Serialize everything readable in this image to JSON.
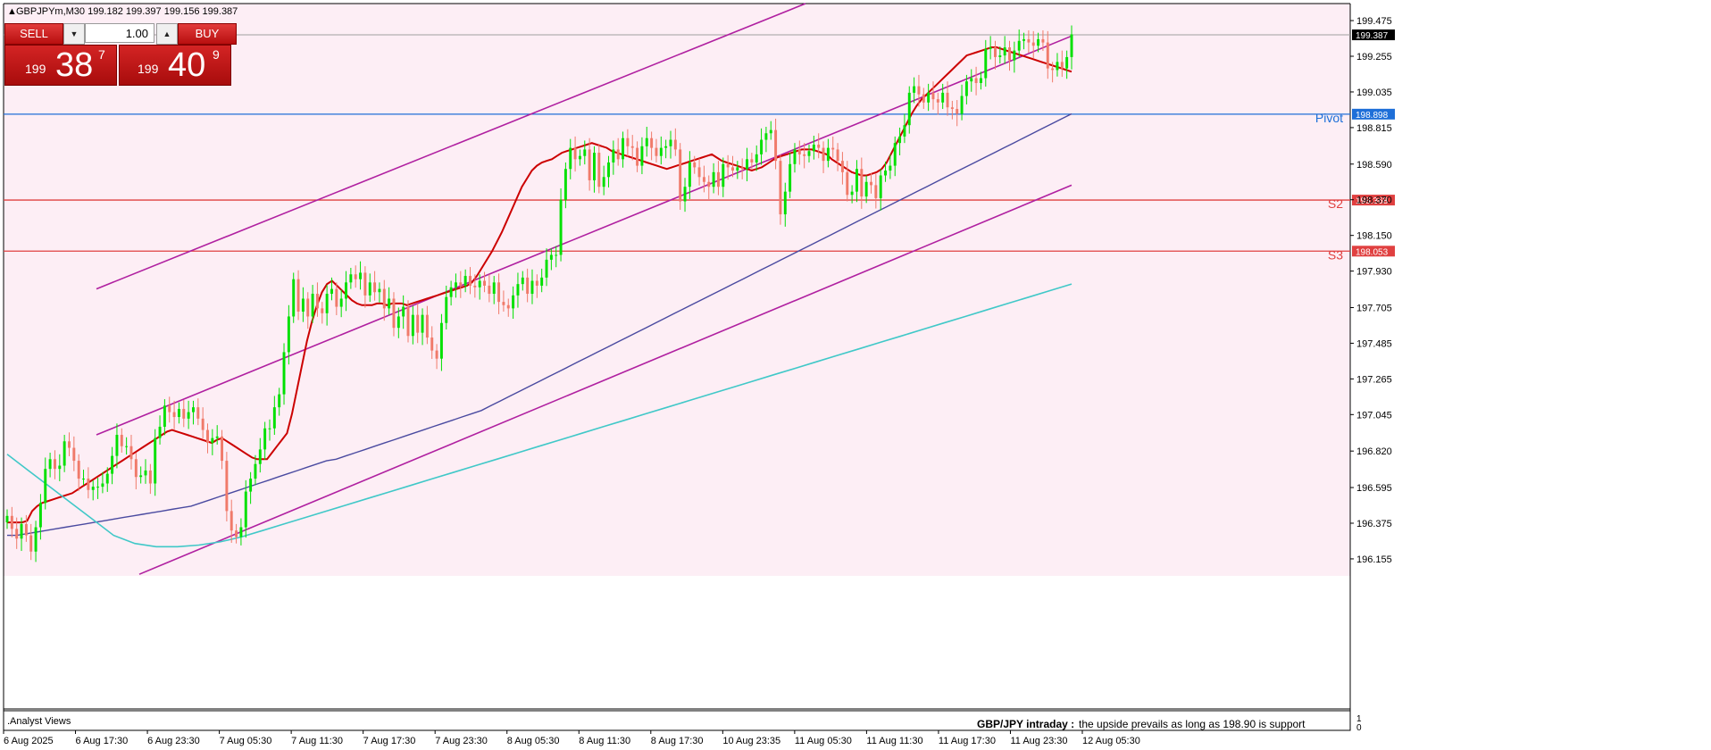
{
  "header": {
    "symbol_line": "GBPJPYm,M30  199.182 199.397 199.156 199.387"
  },
  "trade_panel": {
    "sell_label": "SELL",
    "buy_label": "BUY",
    "lot_value": "1.00",
    "sell_quote": {
      "small": "199",
      "big": "38",
      "sup": "7"
    },
    "buy_quote": {
      "small": "199",
      "big": "40",
      "sup": "9"
    }
  },
  "indicator_panel": {
    "title": ".Analyst Views",
    "comment_bold": "GBP/JPY intraday :",
    "comment_text": " the upside prevails as long as 198.90 is support",
    "scale_top": "1",
    "scale_bottom": "0"
  },
  "colors": {
    "background": "#fdeef5",
    "bull_candle": "#00e000",
    "bear_candle": "#f07a6a",
    "ma_fast": "#cc0000",
    "ma_mid": "#4a4aa0",
    "ma_slow": "#40c8c8",
    "channel": "#b020a0",
    "pivot": "#1e6fd8",
    "support": "#e04040"
  },
  "chart_data": {
    "type": "candlestick",
    "ylim": [
      196.05,
      199.58
    ],
    "y_ticks": [
      "199.475",
      "199.255",
      "199.035",
      "198.815",
      "198.590",
      "198.370",
      "198.150",
      "197.930",
      "197.705",
      "197.485",
      "197.265",
      "197.045",
      "196.820",
      "196.595",
      "196.375",
      "196.155"
    ],
    "x_ticks": [
      "6 Aug 2025",
      "6 Aug 17:30",
      "6 Aug 23:30",
      "7 Aug 05:30",
      "7 Aug 11:30",
      "7 Aug 17:30",
      "7 Aug 23:30",
      "8 Aug 05:30",
      "8 Aug 11:30",
      "8 Aug 17:30",
      "10 Aug 23:35",
      "11 Aug 05:30",
      "11 Aug 11:30",
      "11 Aug 17:30",
      "11 Aug 23:30",
      "12 Aug 05:30"
    ],
    "current_price": "199.387",
    "levels": [
      {
        "name": "Pivot",
        "value": 198.898,
        "label": "198.898"
      },
      {
        "name": "S2",
        "value": 198.368,
        "label": "198.368"
      },
      {
        "name": "S3",
        "value": 198.053,
        "label": "198.053"
      }
    ],
    "closes": [
      196.42,
      196.34,
      196.28,
      196.37,
      196.3,
      196.2,
      196.35,
      196.5,
      196.71,
      196.77,
      196.71,
      196.73,
      196.88,
      196.84,
      196.76,
      196.65,
      196.65,
      196.58,
      196.6,
      196.6,
      196.62,
      196.68,
      196.79,
      196.92,
      196.85,
      196.85,
      196.77,
      196.66,
      196.67,
      196.7,
      196.62,
      196.9,
      196.97,
      197.1,
      197.06,
      197.03,
      197.08,
      197.02,
      197.06,
      197.09,
      197.02,
      196.95,
      196.87,
      196.9,
      196.91,
      196.76,
      196.45,
      196.33,
      196.29,
      196.35,
      196.57,
      196.65,
      196.74,
      196.83,
      196.96,
      196.96,
      197.09,
      197.17,
      197.43,
      197.65,
      197.88,
      197.68,
      197.76,
      197.65,
      197.79,
      197.7,
      197.67,
      197.79,
      197.82,
      197.71,
      197.76,
      197.86,
      197.91,
      197.88,
      197.92,
      197.78,
      197.86,
      197.8,
      197.82,
      197.7,
      197.76,
      197.58,
      197.65,
      197.71,
      197.53,
      197.66,
      197.55,
      197.66,
      197.52,
      197.44,
      197.39,
      197.61,
      197.77,
      197.83,
      197.86,
      197.84,
      197.9,
      197.84,
      197.83,
      197.87,
      197.84,
      197.79,
      197.86,
      197.74,
      197.72,
      197.7,
      197.78,
      197.85,
      197.89,
      197.79,
      197.87,
      197.84,
      197.89,
      198.0,
      198.03,
      198.03,
      198.37,
      198.56,
      198.69,
      198.62,
      198.64,
      198.68,
      198.49,
      198.66,
      198.45,
      198.51,
      198.6,
      198.68,
      198.62,
      198.75,
      198.7,
      198.69,
      198.58,
      198.7,
      198.75,
      198.69,
      198.64,
      198.69,
      198.7,
      198.74,
      198.68,
      198.36,
      198.45,
      198.6,
      198.57,
      198.51,
      198.48,
      198.45,
      198.54,
      198.45,
      198.59,
      198.57,
      198.55,
      198.57,
      198.56,
      198.62,
      198.6,
      198.65,
      198.74,
      198.78,
      198.8,
      198.61,
      198.28,
      198.42,
      198.59,
      198.68,
      198.65,
      198.64,
      198.67,
      198.71,
      198.69,
      198.61,
      198.69,
      198.68,
      198.61,
      198.54,
      198.4,
      198.42,
      198.56,
      198.39,
      198.48,
      198.46,
      198.38,
      198.52,
      198.55,
      198.58,
      198.72,
      198.76,
      198.83,
      199.03,
      199.07,
      199.02,
      198.97,
      199.03,
      198.99,
      198.97,
      199.03,
      198.94,
      198.93,
      198.9,
      199.01,
      199.1,
      199.12,
      199.09,
      199.12,
      199.3,
      199.31,
      199.25,
      199.26,
      199.31,
      199.23,
      199.29,
      199.35,
      199.36,
      199.34,
      199.32,
      199.36,
      199.34,
      199.18,
      199.17,
      199.22,
      199.18,
      199.25,
      199.39
    ],
    "series": [
      {
        "name": "fast MA",
        "values": [
          196.38,
          196.38,
          196.38,
          196.38,
          196.39,
          196.45,
          196.48,
          196.5,
          196.51,
          196.52,
          196.53,
          196.54,
          196.55,
          196.56,
          196.58,
          196.6,
          196.62,
          196.64,
          196.66,
          196.68,
          196.7,
          196.72,
          196.74,
          196.76,
          196.78,
          196.8,
          196.82,
          196.84,
          196.86,
          196.88,
          196.9,
          196.92,
          196.94,
          196.95,
          196.94,
          196.93,
          196.92,
          196.91,
          196.9,
          196.89,
          196.88,
          196.87,
          196.89,
          196.9,
          196.88,
          196.86,
          196.84,
          196.82,
          196.8,
          196.78,
          196.77,
          196.77,
          196.77,
          196.81,
          196.85,
          196.89,
          196.93,
          197.05,
          197.2,
          197.35,
          197.5,
          197.62,
          197.72,
          197.8,
          197.85,
          197.87,
          197.84,
          197.81,
          197.78,
          197.75,
          197.73,
          197.72,
          197.72,
          197.72,
          197.73,
          197.73,
          197.72,
          197.73,
          197.73,
          197.73,
          197.72,
          197.73,
          197.74,
          197.75,
          197.76,
          197.77,
          197.78,
          197.79,
          197.8,
          197.81,
          197.82,
          197.83,
          197.84,
          197.86,
          197.9,
          197.95,
          198.0,
          198.05,
          198.11,
          198.17,
          198.24,
          198.31,
          198.38,
          198.45,
          198.5,
          198.55,
          198.58,
          198.6,
          198.61,
          198.62,
          198.64,
          198.66,
          198.67,
          198.68,
          198.69,
          198.7,
          198.71,
          198.72,
          198.71,
          198.7,
          198.69,
          198.67,
          198.66,
          198.65,
          198.64,
          198.63,
          198.62,
          198.61,
          198.6,
          198.59,
          198.58,
          198.57,
          198.56,
          198.57,
          198.58,
          198.59,
          198.6,
          198.61,
          198.62,
          198.63,
          198.64,
          198.65,
          198.63,
          198.61,
          198.6,
          198.59,
          198.58,
          198.57,
          198.56,
          198.55,
          198.56,
          198.57,
          198.59,
          198.61,
          198.63,
          198.64,
          198.65,
          198.66,
          198.67,
          198.68,
          198.68,
          198.68,
          198.67,
          198.66,
          198.65,
          198.62,
          198.6,
          198.58,
          198.56,
          198.54,
          198.53,
          198.52,
          198.52,
          198.53,
          198.54,
          198.56,
          198.6,
          198.66,
          198.72,
          198.78,
          198.84,
          198.9,
          198.95,
          198.99,
          199.02,
          199.05,
          199.08,
          199.11,
          199.14,
          199.17,
          199.2,
          199.23,
          199.26,
          199.27,
          199.28,
          199.29,
          199.3,
          199.31,
          199.31,
          199.3,
          199.29,
          199.28,
          199.27,
          199.26,
          199.25,
          199.24,
          199.23,
          199.22,
          199.21,
          199.2,
          199.19,
          199.18,
          199.17,
          199.16
        ]
      },
      {
        "name": "mid MA",
        "values": [
          196.3,
          196.3,
          196.31,
          196.32,
          196.33,
          196.34,
          196.35,
          196.36,
          196.37,
          196.38,
          196.39,
          196.4,
          196.41,
          196.42,
          196.43,
          196.44,
          196.45,
          196.46,
          196.47,
          196.48,
          196.5,
          196.52,
          196.54,
          196.56,
          196.58,
          196.6,
          196.62,
          196.64,
          196.66,
          196.68,
          196.7,
          196.72,
          196.74,
          196.76,
          196.77,
          196.79,
          196.81,
          196.83,
          196.85,
          196.87,
          196.89,
          196.91,
          196.93,
          196.95,
          196.97,
          196.99,
          197.01,
          197.03,
          197.05,
          197.07,
          197.1,
          197.13,
          197.16,
          197.19,
          197.22,
          197.25,
          197.28,
          197.31,
          197.34,
          197.37,
          197.4,
          197.43,
          197.46,
          197.49,
          197.52,
          197.55,
          197.58,
          197.61,
          197.64,
          197.67,
          197.7,
          197.73,
          197.76,
          197.79,
          197.82,
          197.85,
          197.88,
          197.91,
          197.94,
          197.97,
          198.0,
          198.03,
          198.06,
          198.09,
          198.12,
          198.15,
          198.18,
          198.21,
          198.24,
          198.27,
          198.3,
          198.33,
          198.36,
          198.39,
          198.42,
          198.45,
          198.48,
          198.51,
          198.54,
          198.57,
          198.6,
          198.63,
          198.66,
          198.69,
          198.72,
          198.75,
          198.78,
          198.81,
          198.84,
          198.87,
          198.9
        ]
      },
      {
        "name": "slow MA",
        "values": [
          196.8,
          196.7,
          196.6,
          196.5,
          196.4,
          196.3,
          196.25,
          196.23,
          196.23,
          196.24,
          196.26,
          196.29,
          196.33,
          196.37,
          196.41,
          196.45,
          196.49,
          196.53,
          196.57,
          196.61,
          196.65,
          196.69,
          196.73,
          196.77,
          196.81,
          196.85,
          196.89,
          196.93,
          196.97,
          197.01,
          197.05,
          197.09,
          197.13,
          197.17,
          197.21,
          197.25,
          197.29,
          197.33,
          197.37,
          197.41,
          197.45,
          197.49,
          197.53,
          197.57,
          197.61,
          197.65,
          197.69,
          197.73,
          197.77,
          197.81,
          197.85
        ]
      }
    ]
  }
}
